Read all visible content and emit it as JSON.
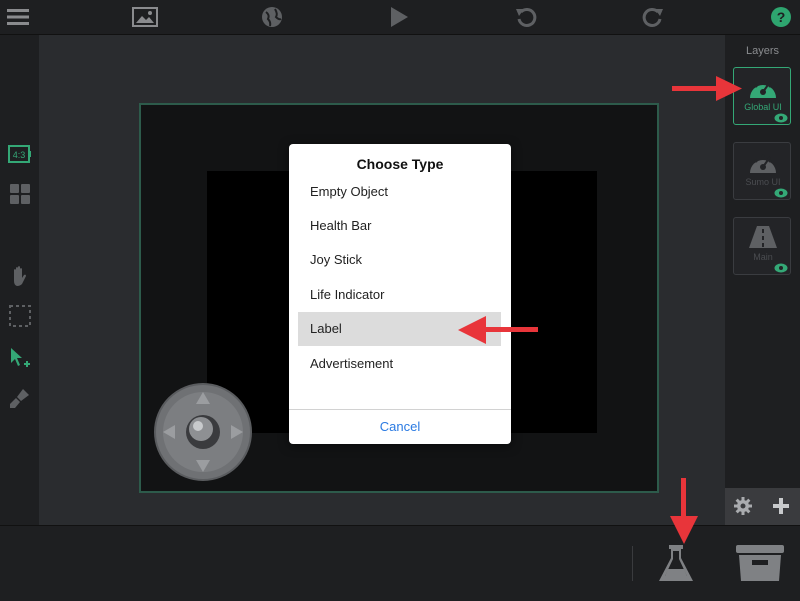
{
  "toolbar": {
    "icons": [
      "menu-icon",
      "image-icon",
      "globe-icon",
      "play-icon",
      "undo-icon",
      "redo-icon",
      "help-icon"
    ],
    "help_color": "#2ea56f"
  },
  "left_tools": {
    "aspect_label": "4:3",
    "icons": [
      "aspect-ratio-icon",
      "grid-icon",
      "hand-icon",
      "selection-icon",
      "pointer-icon",
      "brush-icon"
    ]
  },
  "layers": {
    "title": "Layers",
    "items": [
      {
        "label": "Global UI",
        "active": true
      },
      {
        "label": "Sumo UI",
        "active": false
      },
      {
        "label": "Main",
        "active": false
      }
    ],
    "actions": [
      "gear-icon",
      "plus-icon"
    ]
  },
  "dialog": {
    "title": "Choose Type",
    "options": [
      "Empty Object",
      "Health Bar",
      "Joy Stick",
      "Life Indicator",
      "Label",
      "Advertisement"
    ],
    "selected": "Label",
    "cancel_label": "Cancel"
  },
  "bottom": {
    "icons": [
      "flask-icon",
      "archive-icon"
    ]
  },
  "colors": {
    "accent": "#34a876",
    "annotation": "#e8353a",
    "cancel_text": "#2a7ae2"
  }
}
